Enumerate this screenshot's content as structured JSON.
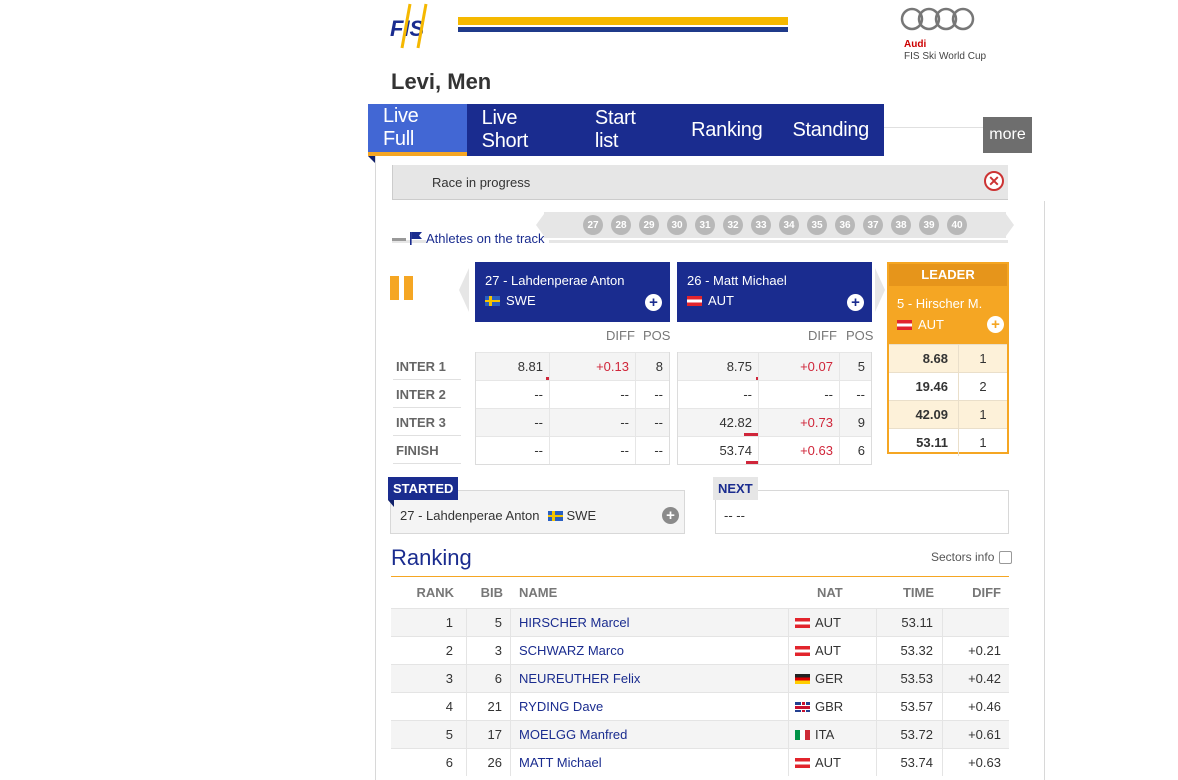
{
  "header": {
    "brand_logo": "FIS",
    "sponsor_name": "Audi",
    "sponsor_sub": "FIS Ski World Cup",
    "page_title": "Levi, Men"
  },
  "nav": {
    "tabs": [
      "Live Full",
      "Live Short",
      "Start list",
      "Ranking",
      "Standing"
    ],
    "active": "Live Full",
    "more_label": "more"
  },
  "status": {
    "text": "Race in progress",
    "close_icon": "close-icon"
  },
  "on_track": {
    "label": "Athletes on the track",
    "bibs": [
      "27",
      "28",
      "29",
      "30",
      "31",
      "32",
      "33",
      "34",
      "35",
      "36",
      "37",
      "38",
      "39",
      "40"
    ]
  },
  "compare": {
    "col_headers": {
      "diff": "DIFF",
      "pos": "POS"
    },
    "intervals": [
      "INTER 1",
      "INTER 2",
      "INTER 3",
      "FINISH"
    ],
    "racer1": {
      "name": "27 - Lahdenperae Anton",
      "nat": "SWE",
      "rows": [
        {
          "time": "8.81",
          "diff": "+0.13",
          "pos": "8"
        },
        {
          "time": "--",
          "diff": "--",
          "pos": "--"
        },
        {
          "time": "--",
          "diff": "--",
          "pos": "--"
        },
        {
          "time": "--",
          "diff": "--",
          "pos": "--"
        }
      ]
    },
    "racer2": {
      "name": "26 - Matt Michael",
      "nat": "AUT",
      "rows": [
        {
          "time": "8.75",
          "diff": "+0.07",
          "pos": "5"
        },
        {
          "time": "--",
          "diff": "--",
          "pos": "--"
        },
        {
          "time": "42.82",
          "diff": "+0.73",
          "pos": "9"
        },
        {
          "time": "53.74",
          "diff": "+0.63",
          "pos": "6"
        }
      ]
    },
    "leader": {
      "label": "LEADER",
      "name": "5 - Hirscher M.",
      "nat": "AUT",
      "rows": [
        {
          "time": "8.68",
          "pos": "1"
        },
        {
          "time": "19.46",
          "pos": "2"
        },
        {
          "time": "42.09",
          "pos": "1"
        },
        {
          "time": "53.11",
          "pos": "1"
        }
      ]
    }
  },
  "started": {
    "label": "STARTED",
    "text": "27 - Lahdenperae Anton",
    "nat": "SWE"
  },
  "next": {
    "label": "NEXT",
    "text": "-- --"
  },
  "ranking": {
    "title": "Ranking",
    "sectors_label": "Sectors info",
    "headers": {
      "rank": "RANK",
      "bib": "BIB",
      "name": "NAME",
      "nat": "NAT",
      "time": "TIME",
      "diff": "DIFF"
    },
    "rows": [
      {
        "rank": "1",
        "bib": "5",
        "name": "HIRSCHER Marcel",
        "nat": "AUT",
        "time": "53.11",
        "diff": ""
      },
      {
        "rank": "2",
        "bib": "3",
        "name": "SCHWARZ Marco",
        "nat": "AUT",
        "time": "53.32",
        "diff": "+0.21"
      },
      {
        "rank": "3",
        "bib": "6",
        "name": "NEUREUTHER Felix",
        "nat": "GER",
        "time": "53.53",
        "diff": "+0.42"
      },
      {
        "rank": "4",
        "bib": "21",
        "name": "RYDING Dave",
        "nat": "GBR",
        "time": "53.57",
        "diff": "+0.46"
      },
      {
        "rank": "5",
        "bib": "17",
        "name": "MOELGG Manfred",
        "nat": "ITA",
        "time": "53.72",
        "diff": "+0.61"
      },
      {
        "rank": "6",
        "bib": "26",
        "name": "MATT Michael",
        "nat": "AUT",
        "time": "53.74",
        "diff": "+0.63"
      }
    ]
  },
  "colors": {
    "brand_blue": "#1a2c8f",
    "accent_orange": "#f5a623",
    "diff_red": "#d0263a"
  }
}
